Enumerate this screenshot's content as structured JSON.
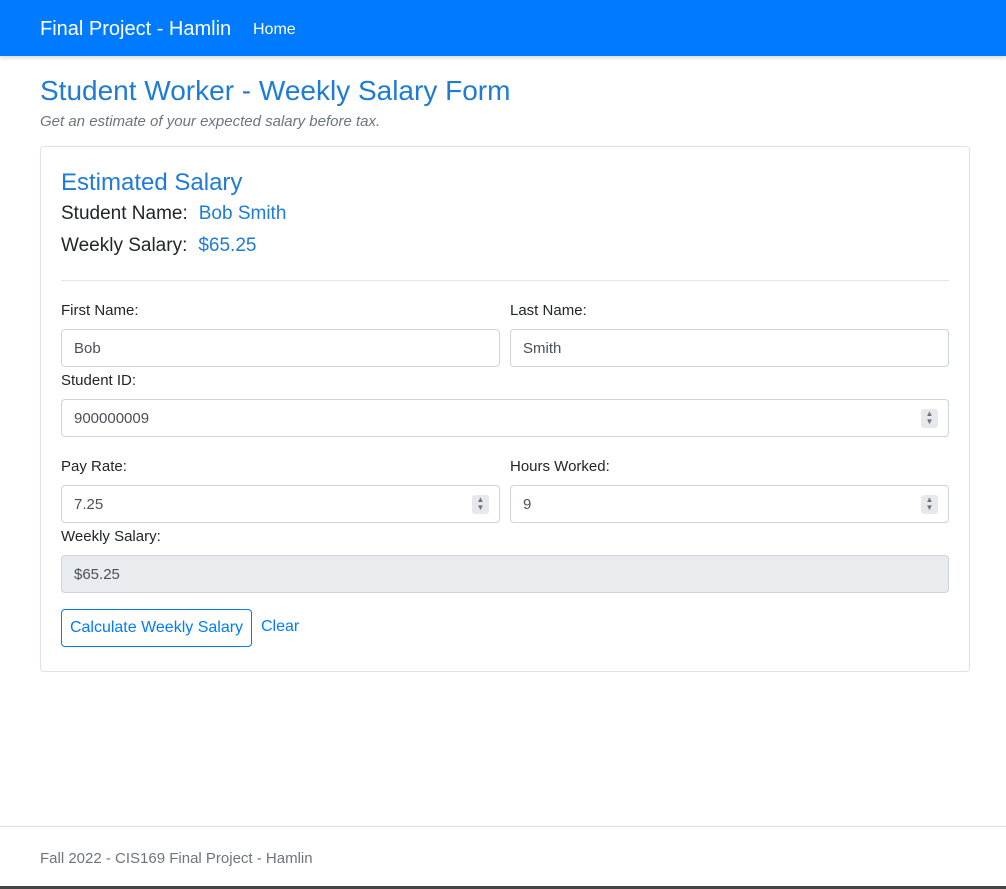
{
  "navbar": {
    "brand": "Final Project - Hamlin",
    "home_link": "Home",
    "color": "#007bff"
  },
  "page": {
    "title": "Student Worker - Weekly Salary Form",
    "subtitle": "Get an estimate of your expected salary before tax."
  },
  "summary": {
    "heading": "Estimated Salary",
    "name_label": "Student Name:",
    "name_value": "Bob Smith",
    "salary_label": "Weekly Salary:",
    "salary_value": "$65.25"
  },
  "form": {
    "first_name_label": "First Name:",
    "first_name_value": "Bob",
    "last_name_label": "Last Name:",
    "last_name_value": "Smith",
    "student_id_label": "Student ID:",
    "student_id_value": "900000009",
    "pay_rate_label": "Pay Rate:",
    "pay_rate_value": "7.25",
    "hours_label": "Hours Worked:",
    "hours_value": "9",
    "weekly_salary_label": "Weekly Salary:",
    "weekly_salary_value": "$65.25"
  },
  "buttons": {
    "calculate": "Calculate Weekly Salary",
    "clear": "Clear"
  },
  "footer": {
    "text": "Fall 2022 - CIS169 Final Project - Hamlin"
  }
}
